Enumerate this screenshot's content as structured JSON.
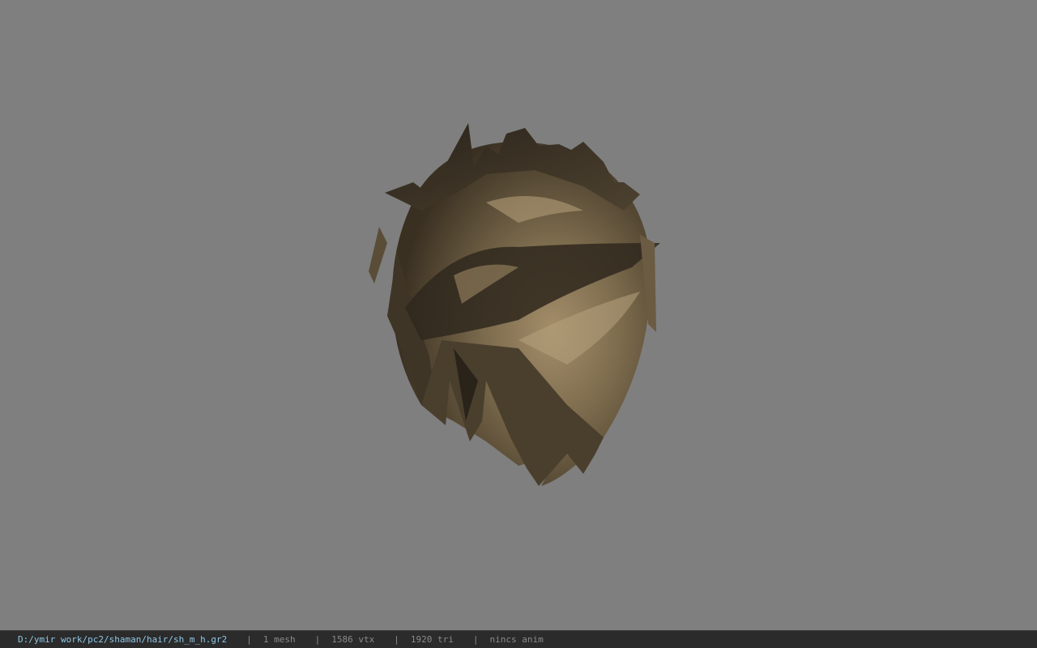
{
  "viewer": {
    "background_color": "#7f7f7f",
    "model_icon": "hair-mesh-model"
  },
  "status_bar": {
    "file_path": "D:/ymir work/pc2/shaman/hair/sh_m_h.gr2",
    "separator": "|",
    "mesh_count": "1 mesh",
    "vertex_count": "1586 vtx",
    "triangle_count": "1920 tri",
    "anim_info": "nincs anim",
    "path_color": "#8fc7e6",
    "text_color": "#8a8a8a"
  }
}
